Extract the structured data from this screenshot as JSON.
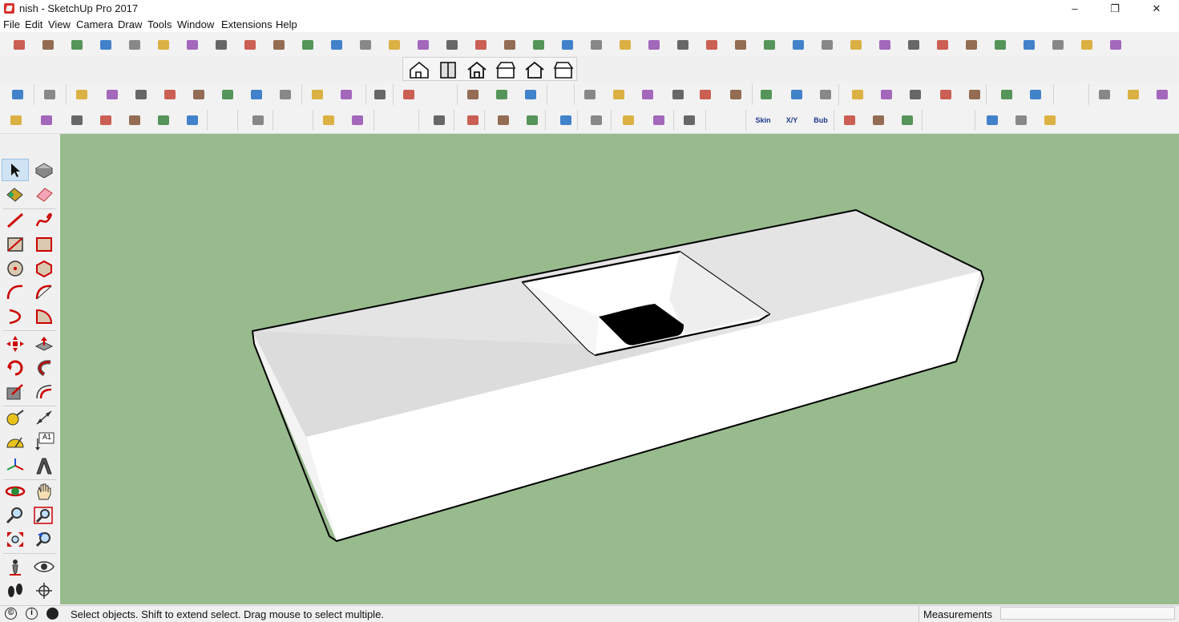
{
  "window": {
    "title": "nish - SketchUp Pro 2017",
    "minimize": "–",
    "restore": "❐",
    "close": "✕"
  },
  "menu": [
    "File",
    "Edit",
    "View",
    "Camera",
    "Draw",
    "Tools",
    "Window",
    "Extensions",
    "Help"
  ],
  "toolbar_labels": {
    "skin": "Skin",
    "xy": "X/Y",
    "bub": "Bub"
  },
  "left_tools_text": {
    "text_tool": "A1"
  },
  "status": {
    "message": "Select objects. Shift to extend select. Drag mouse to select multiple.",
    "measurements_label": "Measurements",
    "measurements_value": ""
  },
  "colors": {
    "viewport_bg": "#98bb8d",
    "model_face": "#ffffff",
    "model_top": "#dedede",
    "edge": "#000000",
    "accent_red": "#d6322e"
  }
}
